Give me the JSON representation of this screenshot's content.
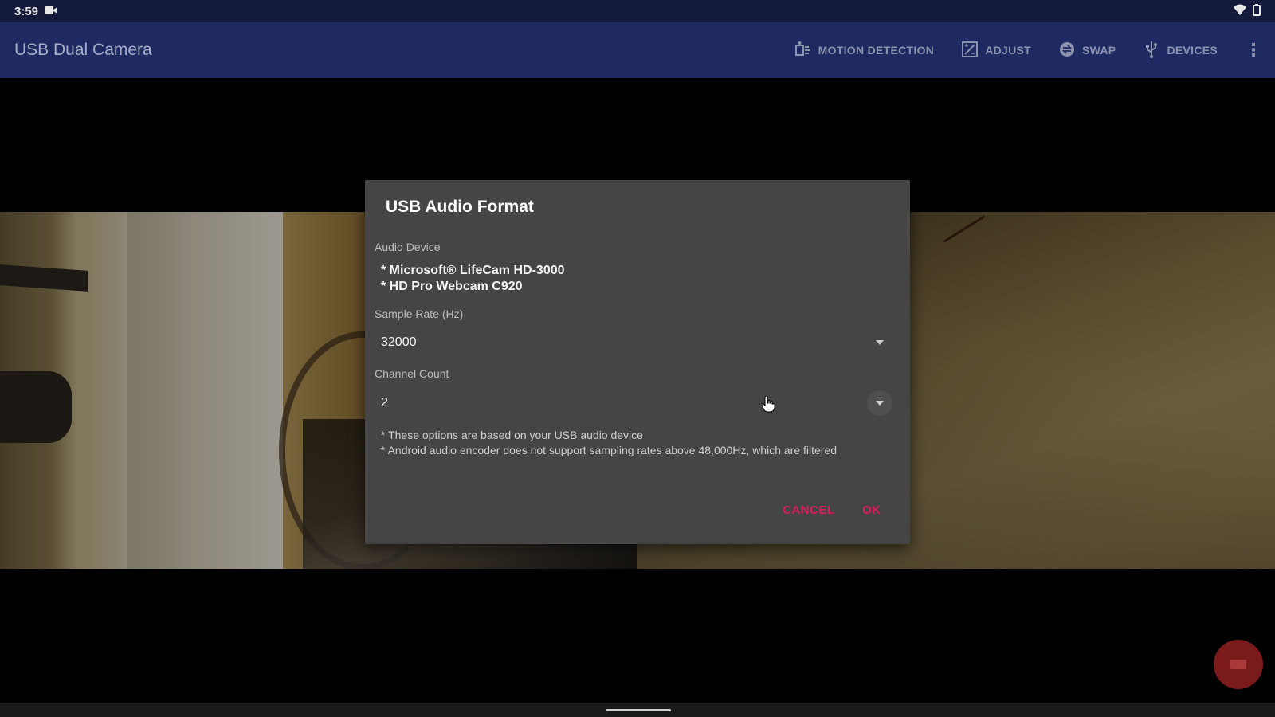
{
  "status_bar": {
    "time": "3:59"
  },
  "toolbar": {
    "title": "USB Dual Camera",
    "actions": [
      {
        "label": "MOTION DETECTION",
        "icon": "motion-detection-icon"
      },
      {
        "label": "ADJUST",
        "icon": "adjust-icon"
      },
      {
        "label": "SWAP",
        "icon": "swap-icon"
      },
      {
        "label": "DEVICES",
        "icon": "usb-icon"
      }
    ],
    "overflow": "⋮"
  },
  "dialog": {
    "title": "USB Audio Format",
    "audio_device_label": "Audio Device",
    "devices": [
      "* Microsoft® LifeCam HD-3000",
      "* HD Pro Webcam C920"
    ],
    "sample_rate_label": "Sample Rate (Hz)",
    "sample_rate_value": "32000",
    "channel_count_label": "Channel Count",
    "channel_count_value": "2",
    "notes": [
      "* These options are based on your USB audio device",
      "* Android audio encoder does not support sampling rates above 48,000Hz, which are filtered"
    ],
    "cancel_label": "CANCEL",
    "ok_label": "OK"
  },
  "colors": {
    "status_bar": "#141b3a",
    "toolbar": "#1f2a63",
    "dialog": "#454545",
    "accent": "#d81b60",
    "fab": "#7a1a1a"
  }
}
